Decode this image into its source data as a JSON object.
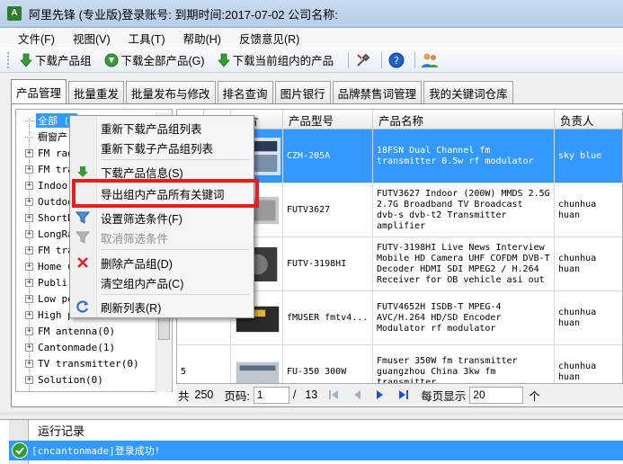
{
  "window": {
    "title": "阿里先锋 (专业版)登录账号:                    到期时间:2017-07-02    公司名称:"
  },
  "menu": [
    "文件(F)",
    "视图(V)",
    "工具(T)",
    "帮助(H)",
    "反馈意见(R)"
  ],
  "toolbar": {
    "download_group": "下载产品组",
    "download_all": "下载全部产品(G)",
    "download_current": "下载当前组内的产品"
  },
  "tabs": [
    "产品管理",
    "批量重发",
    "批量发布与修改",
    "排名查询",
    "图片银行",
    "品牌禁售词管理",
    "我的关键词仓库"
  ],
  "tree": {
    "nodes": [
      {
        "label": "全部 (2",
        "expandable": false,
        "selected": true
      },
      {
        "label": "橱窗产",
        "expandable": false
      },
      {
        "label": "FM rad",
        "expandable": true
      },
      {
        "label": "FM tra",
        "expandable": true
      },
      {
        "label": "Indoor",
        "expandable": true
      },
      {
        "label": "Outdoo",
        "expandable": true
      },
      {
        "label": "ShortR",
        "expandable": true
      },
      {
        "label": "LongRa",
        "expandable": true
      },
      {
        "label": "FM tra",
        "expandable": true
      },
      {
        "label": "Home u",
        "expandable": true
      },
      {
        "label": "Publi",
        "expandable": true
      },
      {
        "label": "Low po",
        "expandable": true
      },
      {
        "label": "High p",
        "expandable": true
      },
      {
        "label": "FM antenna(0)",
        "expandable": true
      },
      {
        "label": "Cantonmade(1)",
        "expandable": true
      },
      {
        "label": "TV transmitter(0)",
        "expandable": true
      },
      {
        "label": "Solution(0)",
        "expandable": true
      }
    ]
  },
  "grid": {
    "columns": [
      "序号",
      "是否",
      "图片",
      "产品型号",
      "产品名称",
      "负责人"
    ],
    "rows": [
      {
        "no": "",
        "model": "CZH-205A",
        "name": "18FSN Dual Channel fm\ntransmitter 0.5w rf modulator",
        "owner": "sky blue",
        "selected": true
      },
      {
        "no": "",
        "model": "FUTV3627",
        "name": "FUTV3627 Indoor (200W) MMDS 2.5G\n2.7G Broadband TV Broadcast\ndvb-s dvb-t2 Transmitter\namplifier",
        "owner": "chunhua huan"
      },
      {
        "no": "",
        "model": "FUTV-3198HI",
        "name": "FUTV-3198HI Live News Interview\nMobile HD Camera UHF COFDM DVB-T\nDecoder HDMI SDI MPEG2 / H.264\nReceiver for OB vehicle asi out",
        "owner": "chunhua huan"
      },
      {
        "no": "",
        "model": "fMUSER fmtv4...",
        "name": "FUTV4652H ISDB-T MPEG-4\nAVC/H.264 HD/SD Encoder\nModulator rf modulator",
        "owner": "chunhua huan"
      },
      {
        "no": "5",
        "model": "FU-350 300W",
        "name": "Fmuser 350W fm transmitter\nguangzhou China 3kw fm\ntransmitter",
        "owner": "chunhua huan"
      }
    ]
  },
  "pager": {
    "total_prefix": "共",
    "total": "250",
    "page_label": "页码:",
    "page": "1",
    "of": "/",
    "pages": "13",
    "per_page_label": "每页显示",
    "per_page": "20",
    "unit": "个"
  },
  "log": {
    "header": "运行记录",
    "message": "[cncantonmade]登录成功!"
  },
  "context_menu": {
    "items": [
      {
        "label": "重新下载产品组列表",
        "enabled": true
      },
      {
        "label": "重新下载子产品组列表",
        "enabled": true
      },
      {
        "label": "下载产品信息(S)",
        "enabled": true
      },
      {
        "label": "导出组内产品所有关键词",
        "enabled": true
      },
      {
        "label": "设置筛选条件(F)",
        "enabled": true
      },
      {
        "label": "取消筛选条件",
        "enabled": false
      },
      {
        "label": "删除产品组(D)",
        "enabled": true
      },
      {
        "label": "清空组内产品(C)",
        "enabled": true
      },
      {
        "label": "刷新列表(R)",
        "enabled": true
      }
    ]
  },
  "colors": {
    "selection": "#3399ff",
    "highlight_box": "#e81e1e",
    "title_gradient": "#c9dcef"
  }
}
